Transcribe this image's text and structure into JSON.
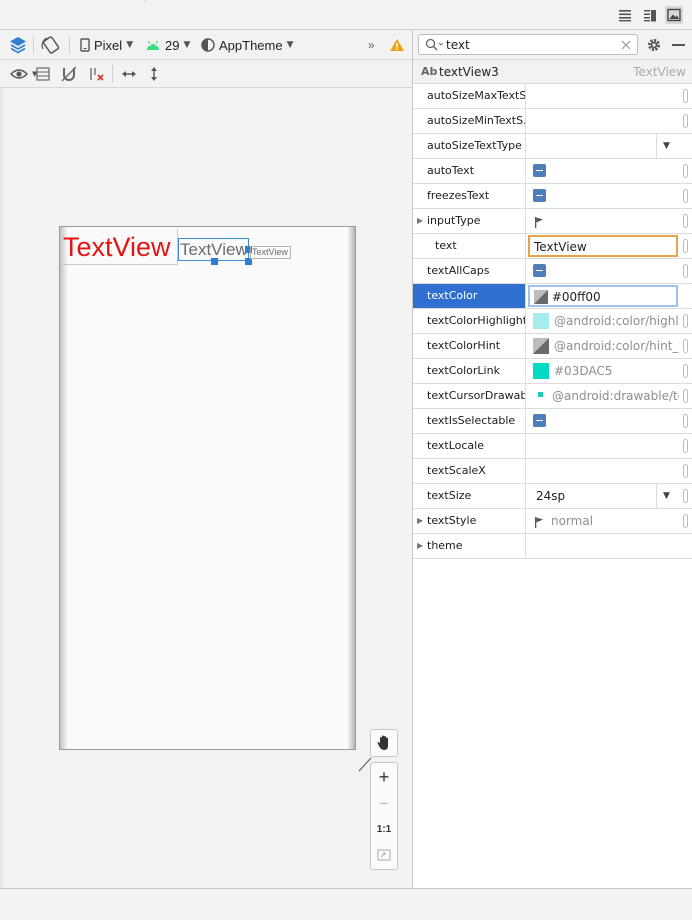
{
  "toolbar": {
    "device": "Pixel",
    "api_level": "29",
    "theme": "AppTheme",
    "overflow": "»"
  },
  "canvas": {
    "textviews": [
      "TextView",
      "TextView",
      "TextView"
    ],
    "colors": {
      "red_text": "#e31414",
      "grey_text": "#6c6c6c",
      "selection": "#2f7fd1"
    }
  },
  "zoom": {
    "zoom_in": "+",
    "zoom_out": "−",
    "actual_size": "1:1"
  },
  "attributes": {
    "search": {
      "value": "text",
      "placeholder": ""
    },
    "component": {
      "icon": "Ab",
      "id": "textView3",
      "type": "TextView"
    },
    "rows": [
      {
        "name": "autoSizeMaxTextS...",
        "value": ""
      },
      {
        "name": "autoSizeMinTextS...",
        "value": ""
      },
      {
        "name": "autoSizeTextType",
        "value": ""
      },
      {
        "name": "autoText",
        "value": ""
      },
      {
        "name": "freezesText",
        "value": ""
      },
      {
        "name": "inputType",
        "value": ""
      },
      {
        "name": "text",
        "value": "TextView"
      },
      {
        "name": "textAllCaps",
        "value": ""
      },
      {
        "name": "textColor",
        "value": "#00ff00"
      },
      {
        "name": "textColorHighlight",
        "value": "@android:color/highlig"
      },
      {
        "name": "textColorHint",
        "value": "@android:color/hint_fc"
      },
      {
        "name": "textColorLink",
        "value": "#03DAC5"
      },
      {
        "name": "textCursorDrawab...",
        "value": "@android:drawable/tex"
      },
      {
        "name": "textIsSelectable",
        "value": ""
      },
      {
        "name": "textLocale",
        "value": ""
      },
      {
        "name": "textScaleX",
        "value": ""
      },
      {
        "name": "textSize",
        "value": "24sp"
      },
      {
        "name": "textStyle",
        "value": "normal"
      },
      {
        "name": "theme",
        "value": ""
      }
    ],
    "swatch_colors": {
      "highlight": "#a6ecec",
      "link": "#03dac5",
      "cursor": "#19cdb8"
    }
  }
}
